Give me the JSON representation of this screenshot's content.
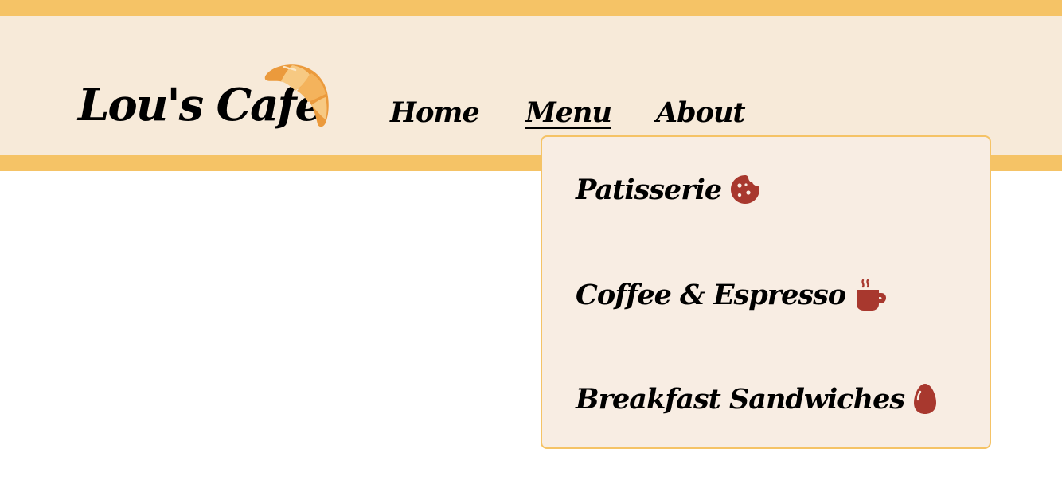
{
  "header": {
    "logo_text": "Lou's Cafe",
    "logo_icon": "croissant-icon"
  },
  "nav": {
    "items": [
      {
        "label": "Home"
      },
      {
        "label": "Menu",
        "active": true
      },
      {
        "label": "About"
      }
    ]
  },
  "dropdown": {
    "items": [
      {
        "label": "Patisserie",
        "icon": "cookie-icon"
      },
      {
        "label": "Coffee & Espresso",
        "icon": "coffee-cup-icon"
      },
      {
        "label": "Breakfast Sandwiches",
        "icon": "egg-icon"
      }
    ]
  },
  "colors": {
    "stripe": "#f5c366",
    "header_bg": "#f7ead9",
    "dropdown_bg": "#f8ede3",
    "icon": "#a8382e",
    "croissant": "#eb9a3c"
  }
}
